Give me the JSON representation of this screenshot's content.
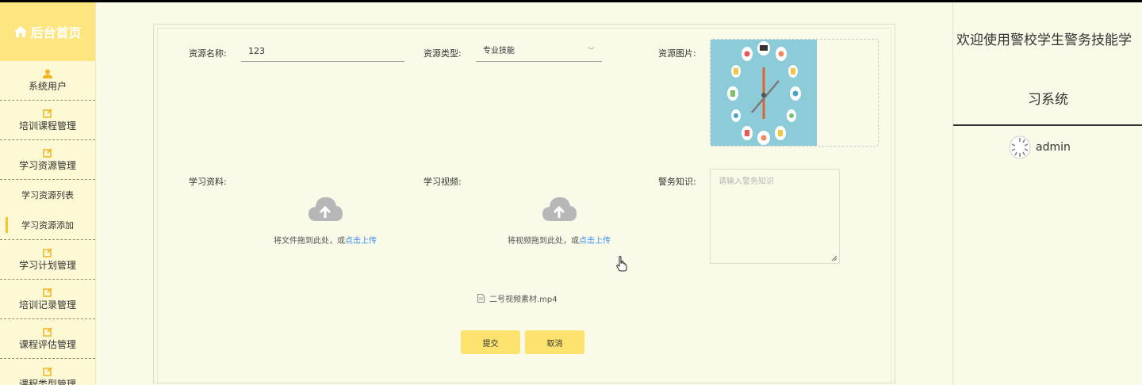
{
  "sidebar": {
    "home_label": "后台首页",
    "items": [
      {
        "label": "系统用户",
        "icon": "user-icon"
      },
      {
        "label": "培训课程管理",
        "icon": "edit-icon"
      },
      {
        "label": "学习资源管理",
        "icon": "edit-icon"
      },
      {
        "label": "学习计划管理",
        "icon": "edit-icon"
      },
      {
        "label": "培训记录管理",
        "icon": "edit-icon"
      },
      {
        "label": "课程评估管理",
        "icon": "edit-icon"
      },
      {
        "label": "课程类型管理",
        "icon": "edit-icon"
      }
    ],
    "subitems": [
      {
        "label": "学习资源列表",
        "active": false
      },
      {
        "label": "学习资源添加",
        "active": true
      }
    ]
  },
  "form": {
    "name_label": "资源名称:",
    "name_value": "123",
    "type_label": "资源类型:",
    "type_value": "专业技能",
    "image_label": "资源图片:",
    "material_label": "学习资料:",
    "video_label": "学习视频:",
    "knowledge_label": "警务知识:",
    "knowledge_placeholder": "请输入警务知识",
    "material_hint": "将文件拖到此处，或",
    "video_hint": "将视频拖到此处，或",
    "upload_link": "点击上传",
    "uploaded_file": "二号视频素材.mp4",
    "submit_label": "提交",
    "cancel_label": "取消"
  },
  "header": {
    "welcome_line1": "欢迎使用警校学生警务技能学",
    "welcome_line2": "习系统",
    "username": "admin"
  },
  "colors": {
    "accent": "#fde680",
    "button": "#fde36e",
    "link": "#3b8ded",
    "background": "#fafae8",
    "sidebar": "#fcf9d4"
  }
}
